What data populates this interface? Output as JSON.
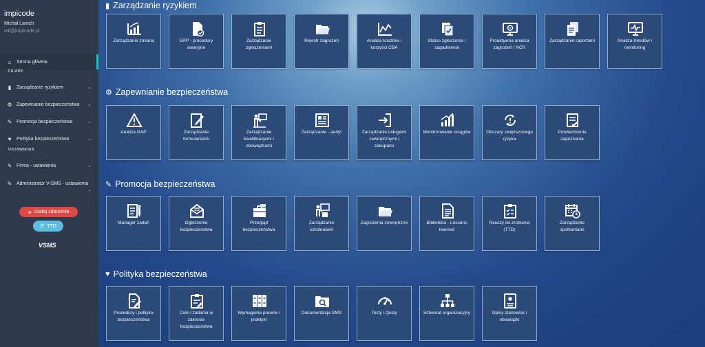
{
  "sidebar": {
    "brand": "impicode",
    "user_name": "Michał Lamch",
    "user_email": "mil@impicode.pl",
    "home": "Strona główna",
    "section_pillars": "FILARY",
    "pillars": [
      "Zarządzanie ryzykiem",
      "Zapewnianie bezpieczeństwa",
      "Promocja bezpieczeństwa",
      "Polityka bezpieczeństwa"
    ],
    "section_settings": "USTAWIENIA",
    "settings": [
      "Firma - ustawienia",
      "Administrator V-SMS - ustawienia"
    ],
    "add_event_label": "Dodaj zdarzenie",
    "ttd_label": "TTD",
    "logo_text": "VSMS",
    "accent_color": "#19c3b4"
  },
  "sections": [
    {
      "title": "Zarządzanie ryzykiem",
      "icon": "bar-chart-icon",
      "tiles": [
        {
          "label": "Zarządzanie zmianą",
          "icon": "chart-growth-icon"
        },
        {
          "label": "ERP - procedury awaryjne",
          "icon": "document-check-icon"
        },
        {
          "label": "Zarządzanie zgłoszeniami",
          "icon": "clipboard-list-icon"
        },
        {
          "label": "Rejestr zagrożeń",
          "icon": "folder-open-icon"
        },
        {
          "label": "Analiza kosztów i korzyści CBA",
          "icon": "line-chart-icon"
        },
        {
          "label": "Status zgłoszenia / zagadnienia",
          "icon": "documents-check-icon"
        },
        {
          "label": "Proaktywna analiza zagrożeń / NCR",
          "icon": "monitor-target-icon"
        },
        {
          "label": "Zarządzanie raportami",
          "icon": "documents-icon"
        },
        {
          "label": "Analiza trendów i monitoring",
          "icon": "monitor-pulse-icon"
        }
      ]
    },
    {
      "title": "Zapewnianie bezpieczeństwa",
      "icon": "gears-icon",
      "tiles": [
        {
          "label": "Analiza GAP",
          "icon": "warning-icon"
        },
        {
          "label": "Zarządzanie formularzami",
          "icon": "form-edit-icon"
        },
        {
          "label": "Zarządzanie kwalifikacjami i obowiązkami",
          "icon": "presenter-icon"
        },
        {
          "label": "Zarządzanie - audyt",
          "icon": "newspaper-icon"
        },
        {
          "label": "Zarządzanie usługami zewnętrznymi i zakupami",
          "icon": "sign-in-icon"
        },
        {
          "label": "Monitorowanie osiągów",
          "icon": "growth-bars-icon"
        },
        {
          "label": "Obszary zwiększonego ryzyka",
          "icon": "refresh-alert-icon"
        },
        {
          "label": "Potwierdzenia zapoznania",
          "icon": "list-check-icon"
        }
      ]
    },
    {
      "title": "Promocja bezpieczeństwa",
      "icon": "edit-document-icon",
      "tiles": [
        {
          "label": "Manager zadań",
          "icon": "task-list-icon"
        },
        {
          "label": "Ogłoszenie bezpieczeństwa",
          "icon": "envelope-icon"
        },
        {
          "label": "Przegląd bezpieczeństwa",
          "icon": "briefcase-icon"
        },
        {
          "label": "Zarządzanie szkoleniami",
          "icon": "training-icon"
        },
        {
          "label": "Zagrożenia zewnętrzne",
          "icon": "folder-open-icon"
        },
        {
          "label": "Biblioteka - Lessons learned",
          "icon": "document-lines-icon"
        },
        {
          "label": "Rzeczy do zrobienia (TTD)",
          "icon": "clipboard-check-icon"
        },
        {
          "label": "Zarządzanie spotkaniami",
          "icon": "calendar-clock-icon"
        }
      ]
    },
    {
      "title": "Polityka bezpieczeństwa",
      "icon": "handshake-icon",
      "tiles": [
        {
          "label": "Procedury i polityka bezpieczeństwa",
          "icon": "document-edit-icon"
        },
        {
          "label": "Cele i zadania w zakresie bezpieczeństwa",
          "icon": "clipboard-edit-icon"
        },
        {
          "label": "Wymagania prawne i praktyki",
          "icon": "binders-icon"
        },
        {
          "label": "Dokumentacja SMS",
          "icon": "folder-search-icon"
        },
        {
          "label": "Testy i Quizy",
          "icon": "gauge-icon"
        },
        {
          "label": "Schemat organizacyjny",
          "icon": "org-chart-icon"
        },
        {
          "label": "Opisy stanowisk i obowiązki",
          "icon": "id-badge-icon"
        }
      ]
    }
  ]
}
